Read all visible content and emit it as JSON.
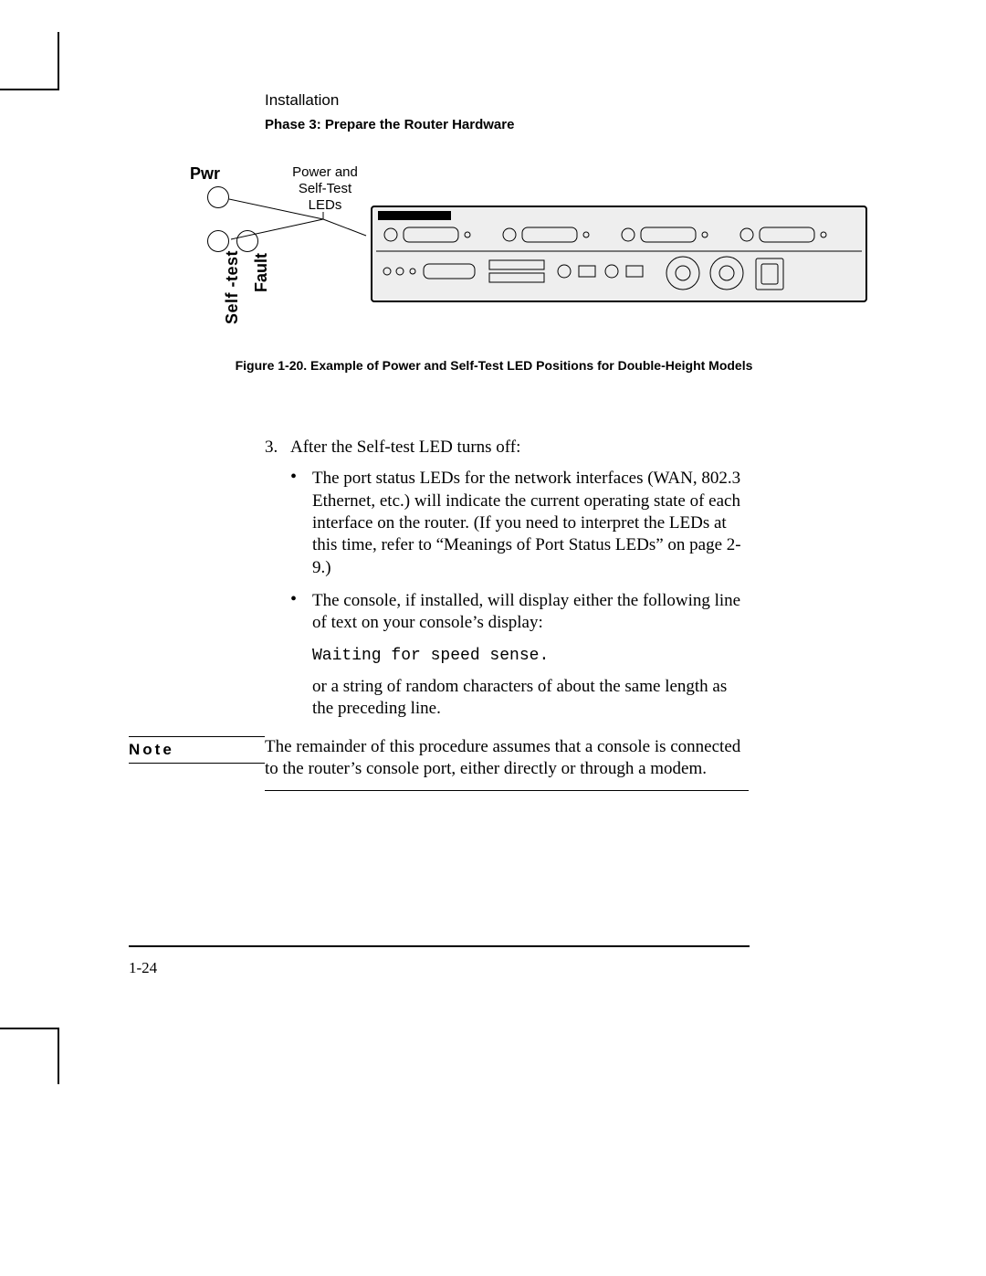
{
  "header": {
    "section": "Installation",
    "phase": "Phase 3: Prepare the Router Hardware"
  },
  "figure": {
    "pwr": "Pwr",
    "selftest": "Self -test",
    "fault": "Fault",
    "callout": "Power and Self-Test LEDs",
    "caption": "Figure  1-20. Example of Power and Self-Test LED Positions for Double-Height Models"
  },
  "body": {
    "step_num": "3.",
    "step_text": "After the Self-test LED turns off:",
    "bullet1": "The port status LEDs for the network interfaces (WAN, 802.3 Ethernet, etc.) will indicate the current operating state of each interface on the router.  (If you need to interpret the LEDs at this time, refer to “Meanings of Port Status LEDs” on page 2-9.)",
    "bullet2": "The console, if installed, will display either the following line of text on your console’s display:",
    "mono": "Waiting for speed sense.",
    "after": "or a string of random characters of about the same length as the preceding line."
  },
  "note": {
    "label": "Note",
    "text": "The remainder of this procedure assumes that a console is connected to the router’s console port, either directly or through a modem."
  },
  "page_number": "1-24"
}
